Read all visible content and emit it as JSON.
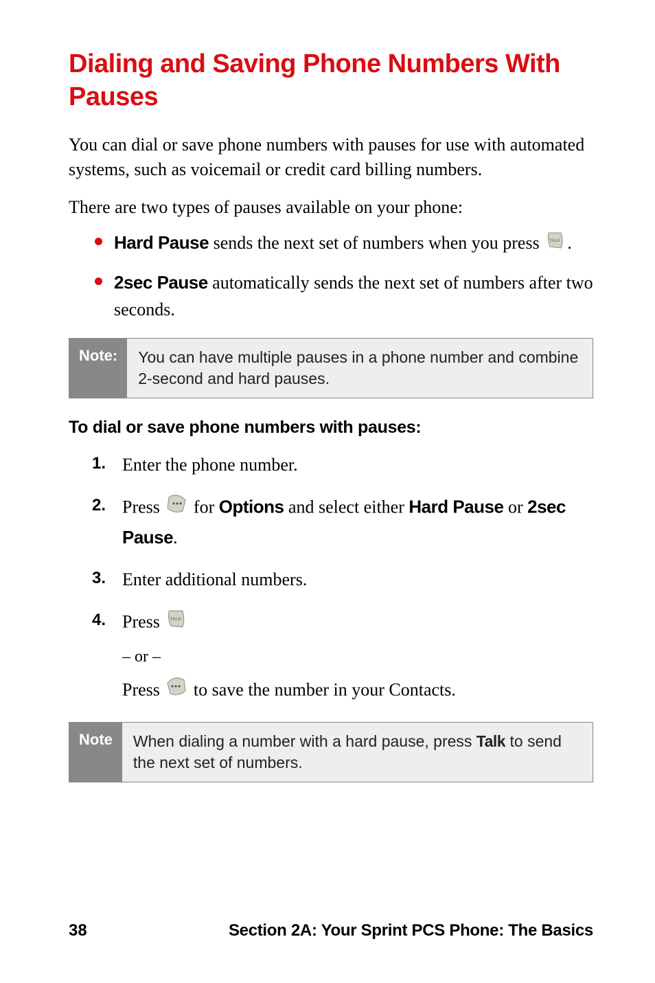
{
  "title": "Dialing and Saving Phone Numbers With Pauses",
  "intro": "You can dial or save phone numbers with pauses for use with automated systems, such as voicemail or credit card billing numbers.",
  "lead": "There are two types of pauses available on your phone:",
  "bullets": [
    {
      "label": "Hard Pause",
      "pre": " sends the next set of numbers when you press ",
      "post": "."
    },
    {
      "label": "2sec Pause",
      "text": " automatically sends the next set of numbers after two seconds."
    }
  ],
  "note1": {
    "label": "Note:",
    "text": "You can have multiple pauses in a phone number and combine 2-second and hard pauses."
  },
  "subhead": "To dial or save phone numbers with pauses:",
  "steps": {
    "s1": "Enter the phone number.",
    "s2_press": "Press ",
    "s2_for": " for ",
    "s2_options": "Options",
    "s2_and": " and select either ",
    "s2_hard": "Hard Pause",
    "s2_or": " or ",
    "s2_2sec": "2sec Pause",
    "s2_period": ".",
    "s3": "Enter additional numbers.",
    "s4_press": "Press ",
    "s4_or": "– or –",
    "s4_press2": "Press ",
    "s4_after": " to save the number in your Contacts."
  },
  "note2": {
    "label": "Note",
    "pre": "When dialing a number with a hard pause, press ",
    "talk": "Talk",
    "post": " to send the next set of numbers."
  },
  "footer": {
    "page": "38",
    "section": "Section 2A: Your Sprint PCS Phone: The Basics"
  },
  "icons": {
    "talk": "talk-key-icon",
    "softkey_right": "softkey-right-icon",
    "softkey_left": "softkey-left-icon"
  }
}
